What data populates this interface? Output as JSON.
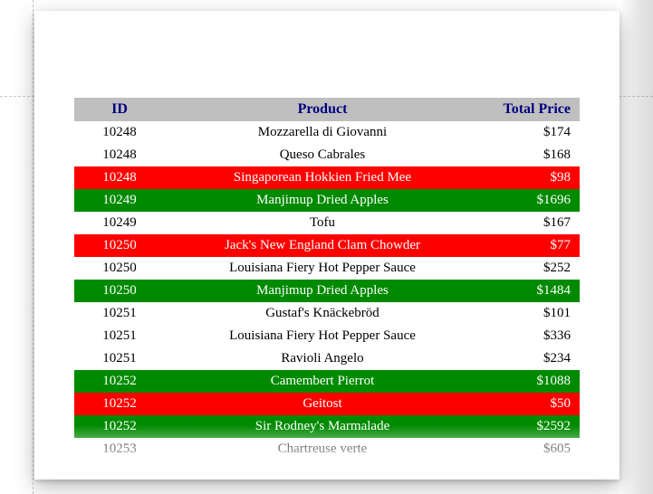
{
  "columns": {
    "id": "ID",
    "product": "Product",
    "total_price": "Total Price"
  },
  "rows": [
    {
      "id": "10248",
      "product": "Mozzarella di Giovanni",
      "total_price": "$174",
      "hl": ""
    },
    {
      "id": "10248",
      "product": "Queso Cabrales",
      "total_price": "$168",
      "hl": ""
    },
    {
      "id": "10248",
      "product": "Singaporean Hokkien Fried Mee",
      "total_price": "$98",
      "hl": "red"
    },
    {
      "id": "10249",
      "product": "Manjimup Dried Apples",
      "total_price": "$1696",
      "hl": "green"
    },
    {
      "id": "10249",
      "product": "Tofu",
      "total_price": "$167",
      "hl": ""
    },
    {
      "id": "10250",
      "product": "Jack's New England Clam Chowder",
      "total_price": "$77",
      "hl": "red"
    },
    {
      "id": "10250",
      "product": "Louisiana Fiery Hot Pepper Sauce",
      "total_price": "$252",
      "hl": ""
    },
    {
      "id": "10250",
      "product": "Manjimup Dried Apples",
      "total_price": "$1484",
      "hl": "green"
    },
    {
      "id": "10251",
      "product": "Gustaf's Knäckebröd",
      "total_price": "$101",
      "hl": ""
    },
    {
      "id": "10251",
      "product": "Louisiana Fiery Hot Pepper Sauce",
      "total_price": "$336",
      "hl": ""
    },
    {
      "id": "10251",
      "product": "Ravioli Angelo",
      "total_price": "$234",
      "hl": ""
    },
    {
      "id": "10252",
      "product": "Camembert Pierrot",
      "total_price": "$1088",
      "hl": "green"
    },
    {
      "id": "10252",
      "product": "Geitost",
      "total_price": "$50",
      "hl": "red"
    },
    {
      "id": "10252",
      "product": "Sir Rodney's Marmalade",
      "total_price": "$2592",
      "hl": "green"
    },
    {
      "id": "10253",
      "product": "Chartreuse verte",
      "total_price": "$605",
      "hl": ""
    }
  ]
}
